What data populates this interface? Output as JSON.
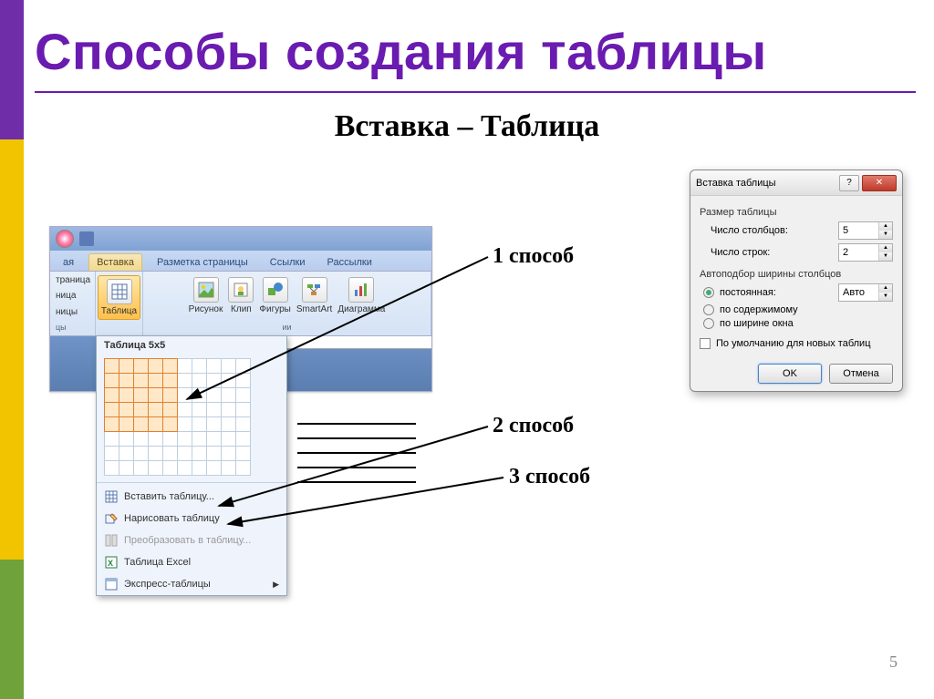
{
  "slide": {
    "title": "Способы создания таблицы",
    "subtitle": "Вставка – Таблица",
    "page_number": "5"
  },
  "callouts": {
    "method1": "1 способ",
    "method2": "2 способ",
    "method3": "3 способ"
  },
  "ribbon": {
    "tabs": {
      "home_frag": "ая",
      "insert": "Вставка",
      "layout": "Разметка страницы",
      "references": "Ссылки",
      "mailings": "Рассылки"
    },
    "page_group_frag1": "траница",
    "page_group_frag2": "ница",
    "page_group_frag3": "ницы",
    "table_btn": "Таблица",
    "picture": "Рисунок",
    "clip": "Клип",
    "shapes": "Фигуры",
    "smartart": "SmartArt",
    "chart": "Диаграмма",
    "illus_frag": "ии"
  },
  "dropdown": {
    "title": "Таблица 5x5",
    "insert_table": "Вставить таблицу...",
    "draw_table": "Нарисовать таблицу",
    "convert": "Преобразовать в таблицу...",
    "excel": "Таблица Excel",
    "quick": "Экспресс-таблицы",
    "grid_cols": 10,
    "grid_rows": 8,
    "sel_cols": 5,
    "sel_rows": 5
  },
  "dialog": {
    "title": "Вставка таблицы",
    "section_size": "Размер таблицы",
    "cols_label": "Число столбцов:",
    "cols_value": "5",
    "rows_label": "Число строк:",
    "rows_value": "2",
    "section_auto": "Автоподбор ширины столбцов",
    "fixed": "постоянная:",
    "fixed_value": "Авто",
    "by_content": "по содержимому",
    "by_window": "по ширине окна",
    "default_new": "По умолчанию для новых таблиц",
    "ok": "OK",
    "cancel": "Отмена"
  }
}
